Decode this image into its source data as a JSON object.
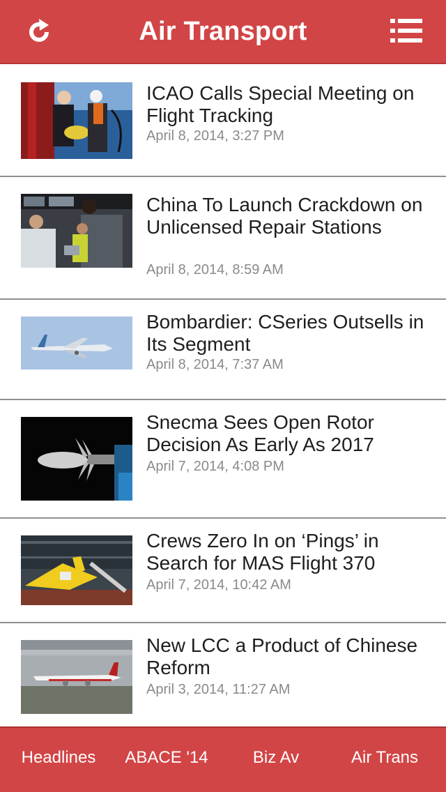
{
  "header": {
    "title": "Air Transport",
    "refresh_icon": "refresh-icon",
    "menu_icon": "list-menu-icon"
  },
  "colors": {
    "brand": "#d24546",
    "headline": "#1e1e1e",
    "date": "#8a8a8a"
  },
  "articles": [
    {
      "title": "ICAO Calls Special Meeting on Flight Tracking",
      "date": "April 8, 2014, 3:27 PM"
    },
    {
      "title": "China To Launch Crackdown on Unlicensed Repair Stations",
      "date": "April 8, 2014, 8:59 AM"
    },
    {
      "title": "Bombardier: CSeries Outsells in Its Segment",
      "date": "April 8, 2014, 7:37 AM"
    },
    {
      "title": "Snecma Sees Open Rotor Decision As Early As 2017",
      "date": "April 7, 2014, 4:08 PM"
    },
    {
      "title": "Crews Zero In on ‘Pings’ in Search for MAS Flight 370",
      "date": "April 7, 2014, 10:42 AM"
    },
    {
      "title": "New LCC a Product of Chinese Reform",
      "date": "April 3, 2014, 11:27 AM"
    }
  ],
  "tabs": [
    {
      "label": "Headlines"
    },
    {
      "label": "ABACE '14"
    },
    {
      "label": "Biz Av"
    },
    {
      "label": "Air Trans"
    }
  ]
}
